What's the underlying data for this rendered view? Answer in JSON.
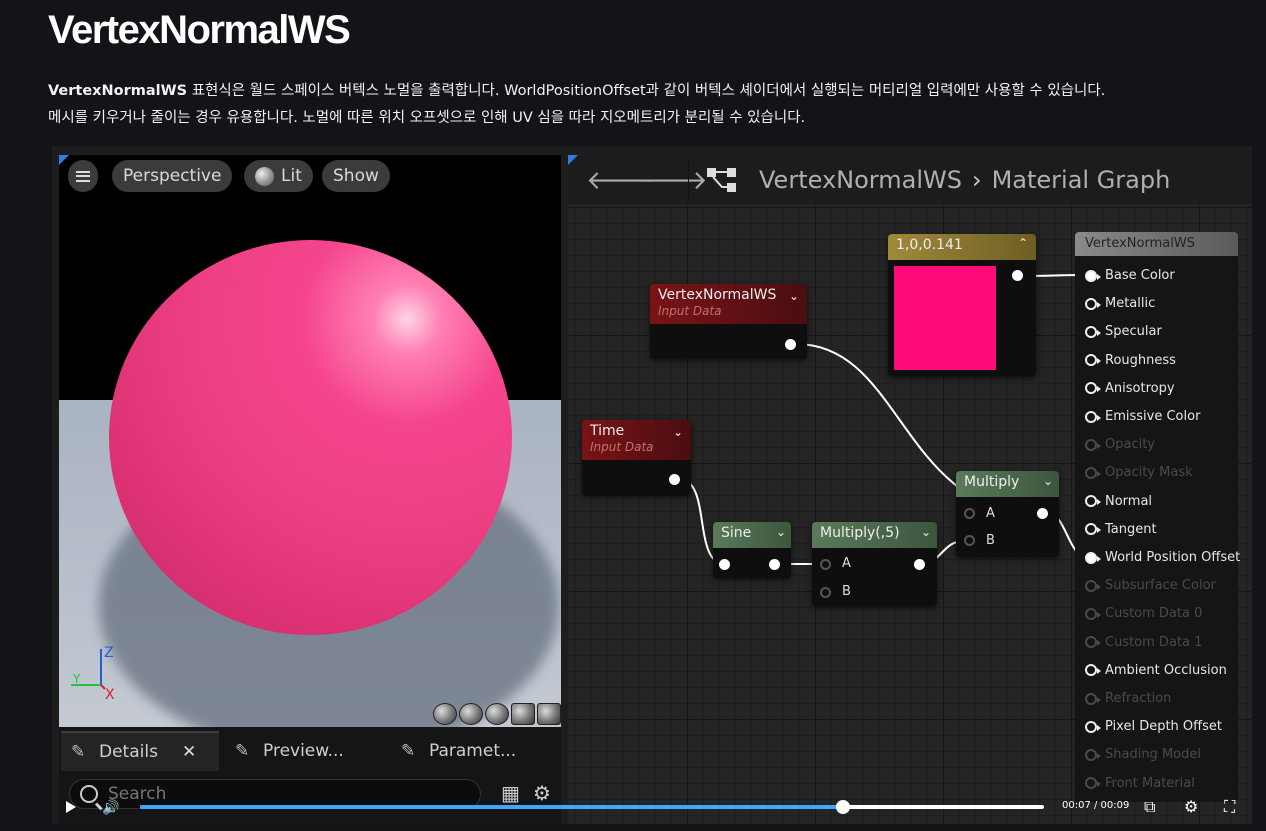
{
  "article": {
    "title": "VertexNormalWS",
    "intro_bold": "VertexNormalWS",
    "intro_line1_rest": " 표현식은 월드 스페이스 버텍스 노멀을 출력합니다. WorldPositionOffset과 같이 버텍스 셰이더에서 실행되는 머티리얼 입력에만 사용할 수 있습니다.",
    "intro_line2": "메시를 키우거나 줄이는 경우 유용합니다. 노멀에 따른 위치 오프셋으로 인해 UV 심을 따라 지오메트리가 분리될 수 있습니다."
  },
  "viewport": {
    "perspective_label": "Perspective",
    "lit_label": "Lit",
    "show_label": "Show",
    "axis_z": "Z",
    "axis_y": "Y",
    "axis_x": "X",
    "sphere_color": "#ec3f82"
  },
  "details_panel": {
    "tabs": [
      {
        "label": "Details"
      },
      {
        "label": "Preview..."
      },
      {
        "label": "Paramet..."
      }
    ],
    "search_placeholder": "Search"
  },
  "graph": {
    "breadcrumb_asset": "VertexNormalWS",
    "breadcrumb_graph": "Material Graph",
    "nodes": {
      "vertex_normal": {
        "title": "VertexNormalWS",
        "subtitle": "Input Data"
      },
      "time": {
        "title": "Time",
        "subtitle": "Input Data"
      },
      "constant": {
        "title": "1,0,0.141",
        "swatch_color": "#ff0a78"
      },
      "sine": {
        "title": "Sine"
      },
      "multiply5": {
        "title": "Multiply(,5)",
        "pin_a": "A",
        "pin_b": "B"
      },
      "multiply": {
        "title": "Multiply",
        "pin_a": "A",
        "pin_b": "B"
      }
    },
    "output_node": {
      "title": "VertexNormalWS",
      "inputs": [
        {
          "label": "Base Color",
          "state": "filled"
        },
        {
          "label": "Metallic",
          "state": "active"
        },
        {
          "label": "Specular",
          "state": "active"
        },
        {
          "label": "Roughness",
          "state": "active"
        },
        {
          "label": "Anisotropy",
          "state": "active"
        },
        {
          "label": "Emissive Color",
          "state": "active"
        },
        {
          "label": "Opacity",
          "state": "disabled"
        },
        {
          "label": "Opacity Mask",
          "state": "disabled"
        },
        {
          "label": "Normal",
          "state": "active"
        },
        {
          "label": "Tangent",
          "state": "active"
        },
        {
          "label": "World Position Offset",
          "state": "filled"
        },
        {
          "label": "Subsurface Color",
          "state": "disabled"
        },
        {
          "label": "Custom Data 0",
          "state": "disabled"
        },
        {
          "label": "Custom Data 1",
          "state": "disabled"
        },
        {
          "label": "Ambient Occlusion",
          "state": "active"
        },
        {
          "label": "Refraction",
          "state": "disabled"
        },
        {
          "label": "Pixel Depth Offset",
          "state": "active"
        },
        {
          "label": "Shading Model",
          "state": "disabled"
        },
        {
          "label": "Front Material",
          "state": "disabled"
        }
      ]
    }
  },
  "player": {
    "timecode": "00:07 / 00:09",
    "progress": 0.778
  }
}
